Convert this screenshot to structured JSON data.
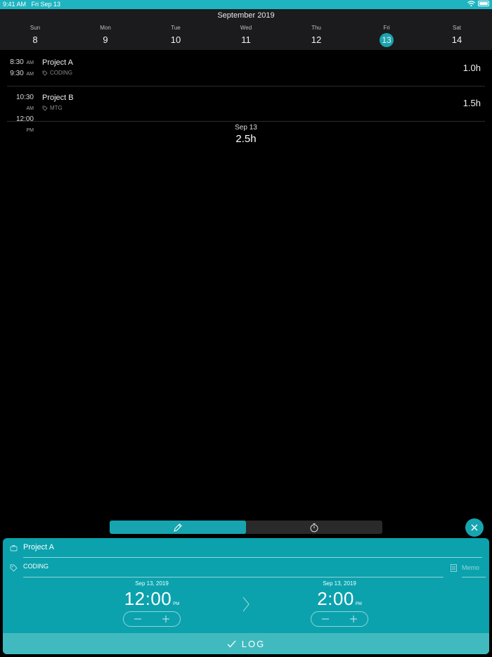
{
  "status": {
    "time": "9:41 AM",
    "date": "Fri Sep 13"
  },
  "calendar": {
    "month": "September 2019",
    "days": [
      {
        "dow": "Sun",
        "num": "8"
      },
      {
        "dow": "Mon",
        "num": "9"
      },
      {
        "dow": "Tue",
        "num": "10"
      },
      {
        "dow": "Wed",
        "num": "11"
      },
      {
        "dow": "Thu",
        "num": "12"
      },
      {
        "dow": "Fri",
        "num": "13"
      },
      {
        "dow": "Sat",
        "num": "14"
      }
    ]
  },
  "entries": [
    {
      "start": "8:30",
      "start_ampm": "AM",
      "end": "9:30",
      "end_ampm": "AM",
      "project": "Project A",
      "tag": "CODING",
      "duration": "1.0h"
    },
    {
      "start": "10:30",
      "start_ampm": "AM",
      "end": "12:00",
      "end_ampm": "PM",
      "project": "Project B",
      "tag": "MTG",
      "duration": "1.5h"
    }
  ],
  "summary": {
    "date": "Sep 13",
    "total": "2.5h"
  },
  "editor": {
    "project": "Project A",
    "tag": "CODING",
    "memo_placeholder": "Memo",
    "start": {
      "date": "Sep 13, 2019",
      "time": "12:00",
      "ampm": "PM"
    },
    "end": {
      "date": "Sep 13, 2019",
      "time": "2:00",
      "ampm": "PM"
    },
    "log_label": "LOG"
  },
  "colors": {
    "accent": "#16a5b0",
    "status_bar": "#1fb4c0",
    "panel": "#0ba2ad",
    "log_button": "#41babf"
  },
  "icons": {
    "mode_edit": "pencil-icon",
    "mode_timer": "stopwatch-icon",
    "close": "close-icon",
    "project": "briefcase-icon",
    "tag": "tag-icon",
    "memo": "document-icon",
    "log": "checkmark-icon"
  }
}
